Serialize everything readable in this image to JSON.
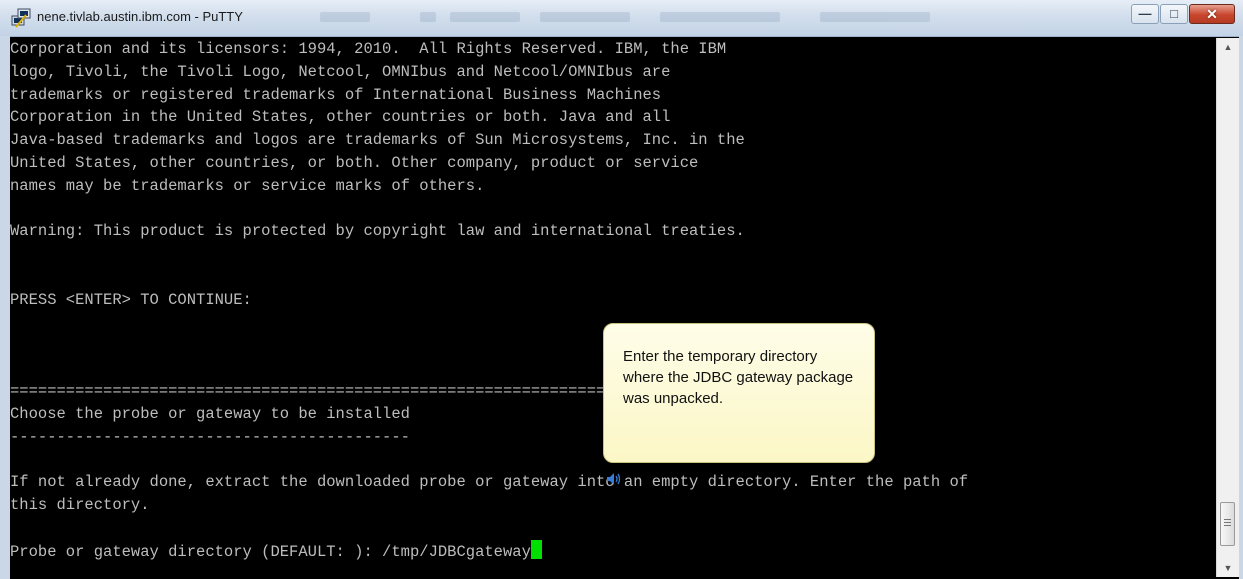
{
  "window": {
    "title": "nene.tivlab.austin.ibm.com - PuTTY",
    "icon": "putty-icon",
    "controls": {
      "minimize_icon": "minimize-icon",
      "maximize_icon": "maximize-icon",
      "close_icon": "close-icon",
      "minimize_glyph": "—",
      "maximize_glyph": "□",
      "close_glyph": "✕"
    }
  },
  "terminal": {
    "lines": [
      "Corporation and its licensors: 1994, 2010.  All Rights Reserved. IBM, the IBM",
      "logo, Tivoli, the Tivoli Logo, Netcool, OMNIbus and Netcool/OMNIbus are",
      "trademarks or registered trademarks of International Business Machines",
      "Corporation in the United States, other countries or both. Java and all",
      "Java-based trademarks and logos are trademarks of Sun Microsystems, Inc. in the",
      "United States, other countries, or both. Other company, product or service",
      "names may be trademarks or service marks of others.",
      "",
      "Warning: This product is protected by copyright law and international treaties.",
      "",
      "",
      "PRESS <ENTER> TO CONTINUE:",
      "",
      "",
      "",
      "===============================================================================",
      "Choose the probe or gateway to be installed",
      "-------------------------------------------",
      "",
      "If not already done, extract the downloaded probe or gateway into an empty directory. Enter the path of",
      "this directory.",
      "",
      "Probe or gateway directory (DEFAULT: ): /tmp/JDBCgateway"
    ],
    "cursor_color": "#00e000",
    "text_color": "#bdbdbd",
    "background": "#000000"
  },
  "scrollbar": {
    "up_glyph": "▲",
    "down_glyph": "▼"
  },
  "callout": {
    "text": "Enter the temporary directory where the JDBC gateway package was unpacked.",
    "background": "#fbf7c6"
  },
  "speaker_icon": "speaker-icon"
}
